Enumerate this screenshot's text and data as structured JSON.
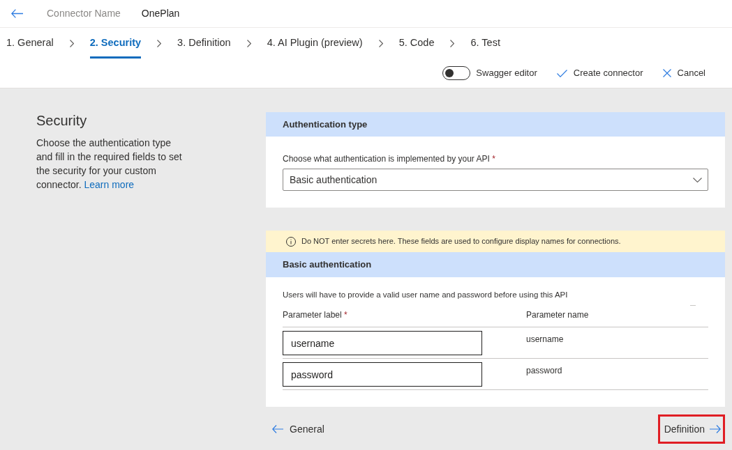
{
  "header": {
    "connector_name_label": "Connector Name",
    "connector_name": "OnePlan"
  },
  "steps": [
    {
      "label": "1. General",
      "selected": false
    },
    {
      "label": "2. Security",
      "selected": true
    },
    {
      "label": "3. Definition",
      "selected": false
    },
    {
      "label": "4. AI Plugin (preview)",
      "selected": false
    },
    {
      "label": "5. Code",
      "selected": false
    },
    {
      "label": "6. Test",
      "selected": false
    }
  ],
  "toolbar": {
    "swagger_editor": {
      "label": "Swagger editor",
      "on": false
    },
    "create_button": "Create connector",
    "cancel_button": "Cancel"
  },
  "intro": {
    "title": "Security",
    "description": "Choose the authentication type and fill in the required fields to set the security for your custom connector.",
    "link": "Learn more"
  },
  "auth_type_card": {
    "title": "Authentication type",
    "field_label": "Choose what authentication is implemented by your API",
    "required_mark": "*",
    "value": "Basic authentication"
  },
  "warning": "Do NOT enter secrets here. These fields are used to configure display names for connections.",
  "basic_auth_card": {
    "title": "Basic authentication",
    "description": "Users will have to provide a valid user name and password before using this API",
    "columns": [
      {
        "label": "Parameter label",
        "required_mark": "*"
      },
      {
        "label": "Parameter name"
      }
    ],
    "rows": [
      {
        "label_value": "username",
        "name": "username"
      },
      {
        "label_value": "password",
        "name": "password"
      }
    ]
  },
  "footer": {
    "back_button": "General",
    "next_button": {
      "label": "Definition",
      "highlighted": true
    }
  }
}
